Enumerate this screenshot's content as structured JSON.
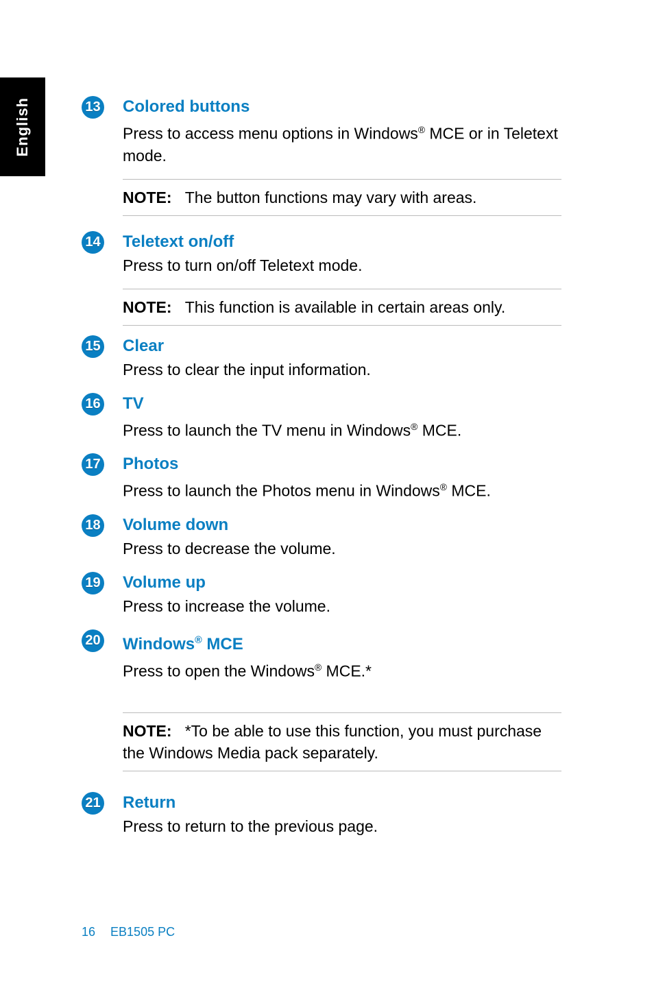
{
  "side_tab": "English",
  "footer": {
    "page": "16",
    "model": "EB1505 PC"
  },
  "items": [
    {
      "num": "13",
      "title": "Colored buttons",
      "desc": "Press to access menu options in Windows® MCE or in Teletext mode."
    },
    {
      "num": "14",
      "title": "Teletext on/off",
      "desc": "Press to turn on/off Teletext mode."
    },
    {
      "num": "15",
      "title": "Clear",
      "desc": "Press to clear the input information."
    },
    {
      "num": "16",
      "title": "TV",
      "desc": "Press to launch the TV menu in Windows® MCE."
    },
    {
      "num": "17",
      "title": "Photos",
      "desc": "Press to launch the Photos menu in Windows® MCE."
    },
    {
      "num": "18",
      "title": "Volume down",
      "desc": "Press to decrease the volume."
    },
    {
      "num": "19",
      "title": "Volume up",
      "desc": "Press to increase the volume."
    },
    {
      "num": "20",
      "title": "Windows® MCE",
      "desc": "Press to open the Windows® MCE.*"
    },
    {
      "num": "21",
      "title": "Return",
      "desc": "Press to return to the previous page."
    }
  ],
  "notes": {
    "label": "NOTE:",
    "n1": "The button functions may vary with areas.",
    "n2": "This function is available in certain areas only.",
    "n3": "*To be able to use this function, you must purchase the Windows Media pack separately."
  }
}
